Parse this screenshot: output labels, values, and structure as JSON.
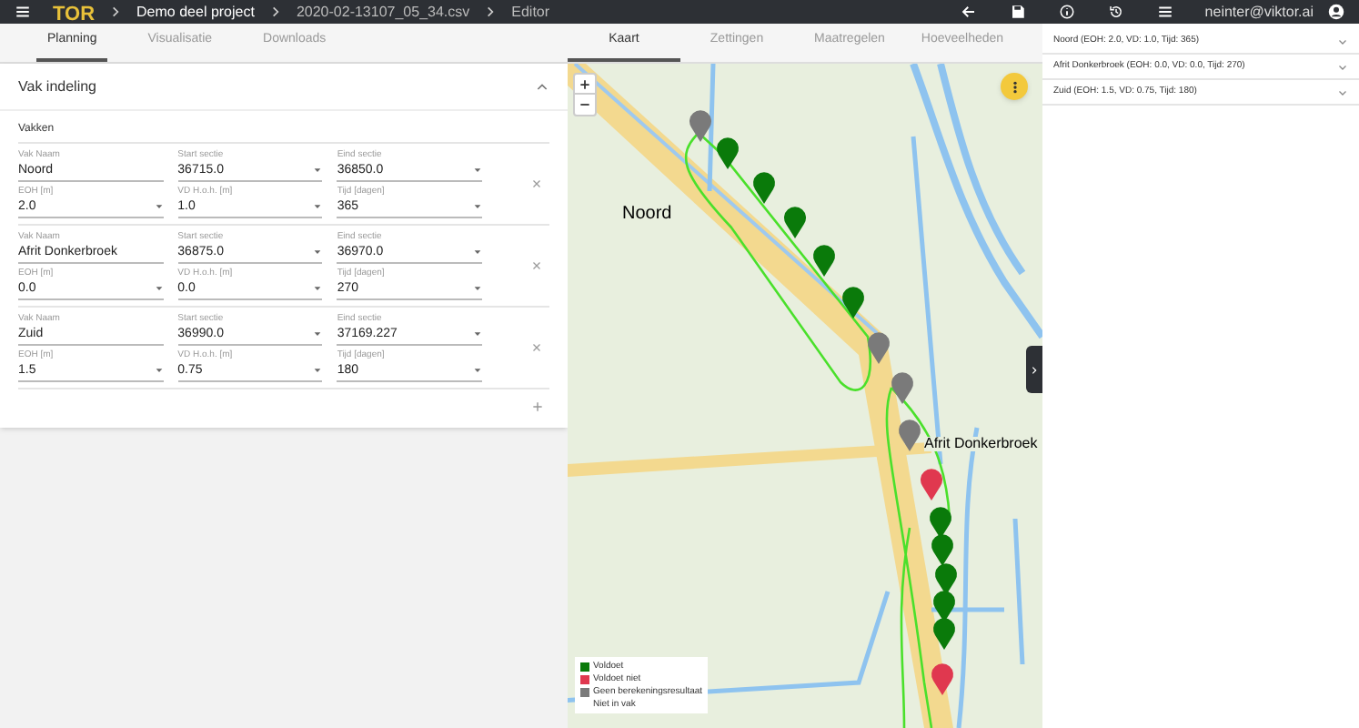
{
  "topbar": {
    "logo": "TOR",
    "breadcrumbs": [
      "Demo deel project",
      "2020-02-13107_05_34.csv",
      "Editor"
    ],
    "user": "neinter@viktor.ai"
  },
  "left_tabs": [
    {
      "label": "Planning",
      "selected": true
    },
    {
      "label": "Visualisatie",
      "selected": false
    },
    {
      "label": "Downloads",
      "selected": false
    }
  ],
  "section": {
    "title": "Vak indeling",
    "expanded": true,
    "list_label": "Vakken",
    "rows": [
      {
        "fields": [
          {
            "label": "Vak Naam",
            "value": "Noord",
            "kind": "text"
          },
          {
            "label": "Start sectie",
            "value": "36715.0",
            "kind": "select"
          },
          {
            "label": "Eind sectie",
            "value": "36850.0",
            "kind": "select"
          },
          {
            "label": "EOH [m]",
            "value": "2.0",
            "kind": "select"
          },
          {
            "label": "VD H.o.h. [m]",
            "value": "1.0",
            "kind": "select"
          },
          {
            "label": "Tijd [dagen]",
            "value": "365",
            "kind": "select"
          }
        ]
      },
      {
        "fields": [
          {
            "label": "Vak Naam",
            "value": "Afrit Donkerbroek",
            "kind": "text"
          },
          {
            "label": "Start sectie",
            "value": "36875.0",
            "kind": "select"
          },
          {
            "label": "Eind sectie",
            "value": "36970.0",
            "kind": "select"
          },
          {
            "label": "EOH [m]",
            "value": "0.0",
            "kind": "select"
          },
          {
            "label": "VD H.o.h. [m]",
            "value": "0.0",
            "kind": "select"
          },
          {
            "label": "Tijd [dagen]",
            "value": "270",
            "kind": "select"
          }
        ]
      },
      {
        "fields": [
          {
            "label": "Vak Naam",
            "value": "Zuid",
            "kind": "text"
          },
          {
            "label": "Start sectie",
            "value": "36990.0",
            "kind": "select"
          },
          {
            "label": "Eind sectie",
            "value": "37169.227",
            "kind": "select"
          },
          {
            "label": "EOH [m]",
            "value": "1.5",
            "kind": "select"
          },
          {
            "label": "VD H.o.h. [m]",
            "value": "0.75",
            "kind": "select"
          },
          {
            "label": "Tijd [dagen]",
            "value": "180",
            "kind": "select"
          }
        ]
      }
    ]
  },
  "right_tabs": [
    {
      "label": "Kaart",
      "selected": true
    },
    {
      "label": "Zettingen",
      "selected": false
    },
    {
      "label": "Maatregelen",
      "selected": false
    },
    {
      "label": "Hoeveelheden",
      "selected": false
    }
  ],
  "map": {
    "labels": [
      "Noord",
      "Afrit Donkerbroek"
    ],
    "markers": [
      {
        "color": "#7a7a7a"
      },
      {
        "color": "#0a7a0a"
      },
      {
        "color": "#0a7a0a"
      },
      {
        "color": "#0a7a0a"
      },
      {
        "color": "#0a7a0a"
      },
      {
        "color": "#0a7a0a"
      },
      {
        "color": "#7a7a7a"
      },
      {
        "color": "#7a7a7a"
      },
      {
        "color": "#7a7a7a"
      },
      {
        "color": "#e0384f"
      },
      {
        "color": "#0a7a0a"
      },
      {
        "color": "#0a7a0a"
      },
      {
        "color": "#0a7a0a"
      },
      {
        "color": "#0a7a0a"
      },
      {
        "color": "#0a7a0a"
      },
      {
        "color": "#e0384f"
      }
    ],
    "legend": [
      {
        "label": "Voldoet",
        "color": "#0a7a0a"
      },
      {
        "label": "Voldoet niet",
        "color": "#e0384f"
      },
      {
        "label": "Geen berekeningsresultaat",
        "color": "#7a7a7a"
      },
      {
        "label": "Niet in vak"
      }
    ]
  },
  "results": [
    {
      "label": "Noord (EOH: 2.0, VD: 1.0, Tijd: 365)",
      "expanded": false
    },
    {
      "label": "Afrit Donkerbroek (EOH: 0.0, VD: 0.0, Tijd: 270)",
      "expanded": false
    },
    {
      "label": "Zuid (EOH: 1.5, VD: 0.75, Tijd: 180)",
      "expanded": false
    }
  ]
}
